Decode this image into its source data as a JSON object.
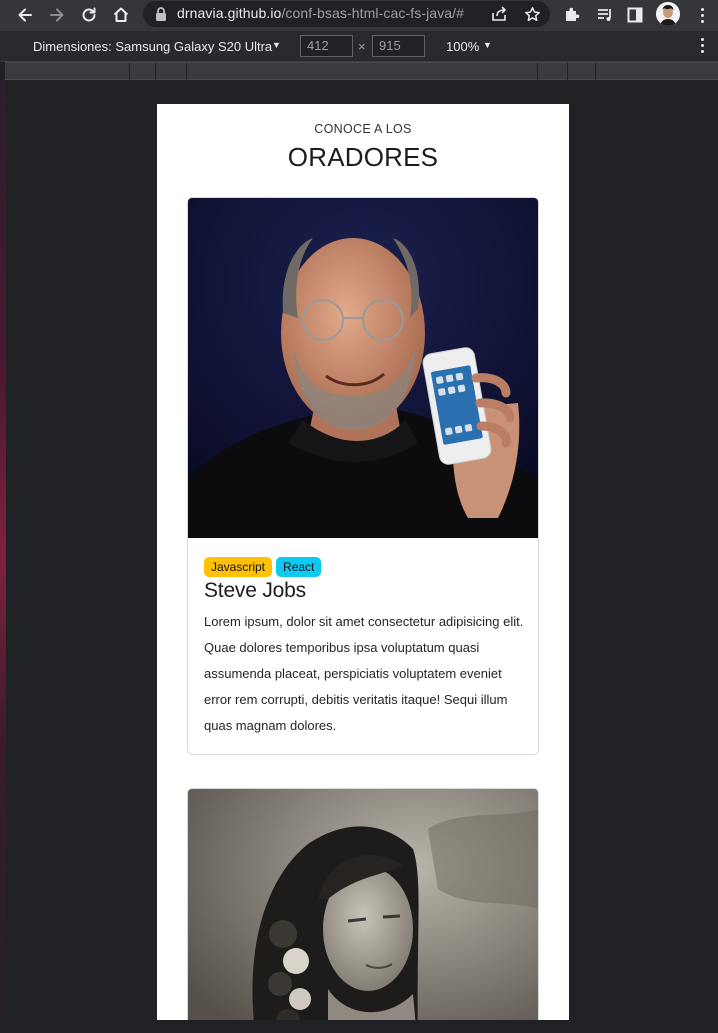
{
  "browser": {
    "url_host": "drnavia.github.io",
    "url_path": "/conf-bsas-html-cac-fs-java/#"
  },
  "devtools": {
    "device_label": "Dimensiones: Samsung Galaxy S20 Ultra",
    "width_value": "412",
    "height_value": "915",
    "times_sign": "×",
    "zoom_label": "100%"
  },
  "page": {
    "kicker": "CONOCE A LOS",
    "heading": "ORADORES",
    "speakers": [
      {
        "tags": [
          "Javascript",
          "React"
        ],
        "name": "Steve Jobs",
        "description": "Lorem ipsum, dolor sit amet consectetur adipisicing elit. Quae dolores temporibus ipsa voluptatum quasi assumenda placeat, perspiciatis voluptatem eveniet error rem corrupti, debitis veritatis itaque! Sequi illum quas magnam dolores."
      }
    ]
  },
  "colors": {
    "badge_javascript": "#ffc107",
    "badge_react": "#0dcaf0",
    "chrome_bar": "#35363a",
    "devtools_bar": "#292a2d"
  },
  "icons": [
    "back-arrow-icon",
    "forward-arrow-icon",
    "reload-icon",
    "home-icon",
    "lock-icon",
    "share-icon",
    "star-icon",
    "puzzle-extension-icon",
    "media-playlist-icon",
    "side-panel-icon",
    "profile-avatar",
    "kebab-menu-icon"
  ]
}
